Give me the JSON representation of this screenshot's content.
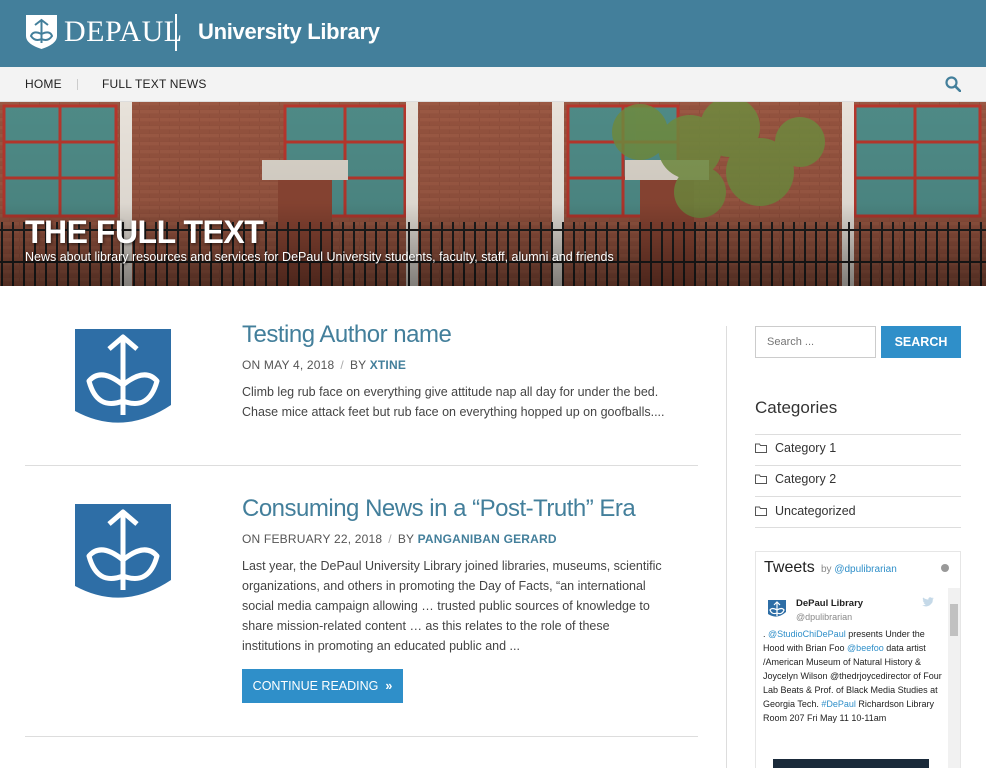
{
  "header": {
    "brand": "DEPAUL",
    "site_title": "University Library"
  },
  "nav": {
    "items": [
      "HOME",
      "FULL TEXT NEWS"
    ]
  },
  "hero": {
    "title": "THE FULL TEXT",
    "subtitle": "News about library resources and services for DePaul University students, faculty, staff, alumni and friends"
  },
  "posts": [
    {
      "title": "Testing Author name",
      "date": "ON MAY 4, 2018",
      "by": "BY",
      "author": "XTINE",
      "excerpt": "Climb leg rub face on everything give attitude nap all day for under the bed. Chase mice attack feet but rub face on everything hopped up on goofballs...."
    },
    {
      "title": "Consuming News in a “Post-Truth” Era",
      "date": "ON FEBRUARY 22, 2018",
      "by": "BY",
      "author": "PANGANIBAN GERARD",
      "excerpt": "Last year, the DePaul University Library joined libraries, museums, scientific organizations, and others in promoting the Day of Facts, “an international social media campaign allowing … trusted public sources of knowledge to share mission-related content … as this relates to the role of these institutions in promoting an educated public and ...",
      "button": "CONTINUE READING"
    }
  ],
  "sidebar": {
    "search_placeholder": "Search ...",
    "search_button": "SEARCH",
    "categories_heading": "Categories",
    "categories": [
      "Category 1",
      "Category 2",
      "Uncategorized"
    ]
  },
  "tweets": {
    "title": "Tweets",
    "by": "by",
    "handle_link": "@dpulibrarian",
    "author_name": "DePaul Library",
    "author_handle": "@dpulibrarian",
    "text_prefix": ". ",
    "mention1": "@StudioChiDePaul",
    "text1": " presents Under the Hood with Brian Foo ",
    "mention2": "@beefoo",
    "text2": " data artist /American Museum of Natural History & Joycelyn Wilson @thedrjoycedirector of Four Lab Beats & Prof. of Black Media Studies at Georgia Tech. ",
    "hashtag": "#DePaul",
    "text3": " Richardson Library Room 207 Fri May 11 10-11am"
  },
  "colors": {
    "brand_blue": "#437f9b",
    "button_blue": "#2f8fc9"
  }
}
